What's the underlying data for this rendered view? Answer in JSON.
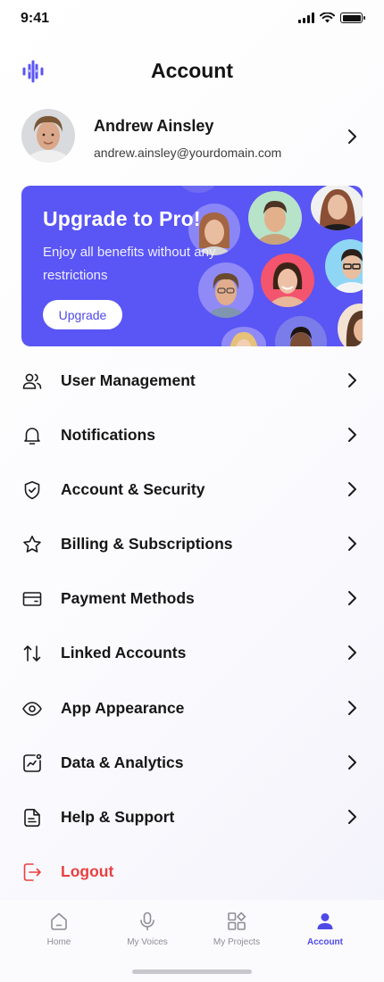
{
  "status_bar": {
    "time": "9:41"
  },
  "header": {
    "title": "Account",
    "logo_icon": "sound-wave-logo"
  },
  "profile": {
    "name": "Andrew Ainsley",
    "email": "andrew.ainsley@yourdomain.com"
  },
  "banner": {
    "title": "Upgrade to Pro!",
    "description": "Enjoy all benefits without any restrictions",
    "button_label": "Upgrade",
    "background_color": "#5a55f5"
  },
  "menu": {
    "items": [
      {
        "label": "User Management",
        "icon": "users-icon"
      },
      {
        "label": "Notifications",
        "icon": "bell-icon"
      },
      {
        "label": "Account & Security",
        "icon": "shield-icon"
      },
      {
        "label": "Billing & Subscriptions",
        "icon": "star-icon"
      },
      {
        "label": "Payment Methods",
        "icon": "card-icon"
      },
      {
        "label": "Linked Accounts",
        "icon": "arrows-icon"
      },
      {
        "label": "App Appearance",
        "icon": "eye-icon"
      },
      {
        "label": "Data & Analytics",
        "icon": "chart-icon"
      },
      {
        "label": "Help & Support",
        "icon": "document-icon"
      }
    ],
    "logout_label": "Logout",
    "logout_color": "#ea3f3f"
  },
  "bottom_nav": {
    "items": [
      {
        "label": "Home",
        "icon": "home-icon",
        "active": false
      },
      {
        "label": "My Voices",
        "icon": "microphone-icon",
        "active": false
      },
      {
        "label": "My Projects",
        "icon": "grid-icon",
        "active": false
      },
      {
        "label": "Account",
        "icon": "person-icon",
        "active": true
      }
    ],
    "accent_color": "#4f49e8"
  }
}
